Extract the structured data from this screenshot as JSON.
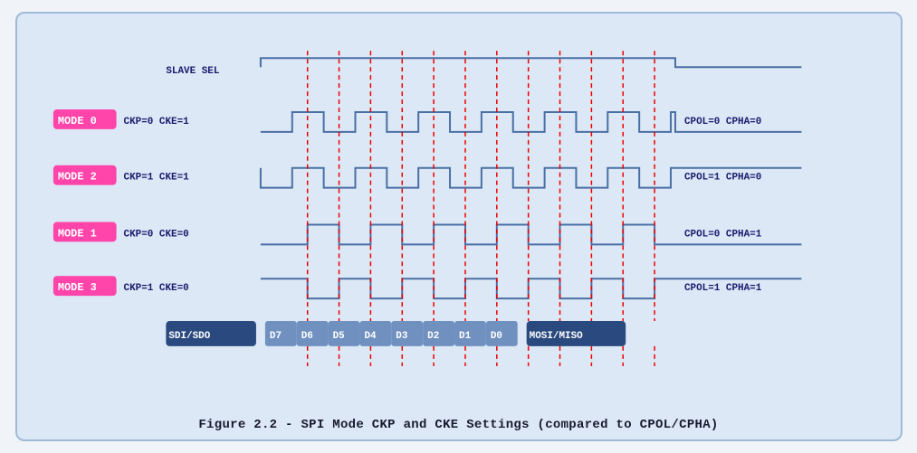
{
  "caption": "Figure 2.2 - SPI Mode CKP and CKE Settings (compared to CPOL/CPHA)",
  "modes": [
    {
      "label": "MODE 0",
      "ck_label": "CKP=0  CKE=1",
      "right_label": "CPOL=0  CPHA=0",
      "row": 0,
      "idle_high": false
    },
    {
      "label": "MODE 2",
      "ck_label": "CKP=1  CKE=1",
      "right_label": "CPOL=1  CPHA=0",
      "row": 1,
      "idle_high": true
    },
    {
      "label": "MODE 1",
      "ck_label": "CKP=0  CKE=0",
      "right_label": "CPOL=0  CPHA=1",
      "row": 2,
      "idle_high": false
    },
    {
      "label": "MODE 3",
      "ck_label": "CKP=1  CKE=0",
      "right_label": "CPOL=1  CPHA=1",
      "row": 3,
      "idle_high": true
    }
  ],
  "data_bits": [
    "SDI/SDO",
    "D7",
    "D6",
    "D5",
    "D4",
    "D3",
    "D2",
    "D1",
    "D0",
    "MOSI/MISO"
  ]
}
